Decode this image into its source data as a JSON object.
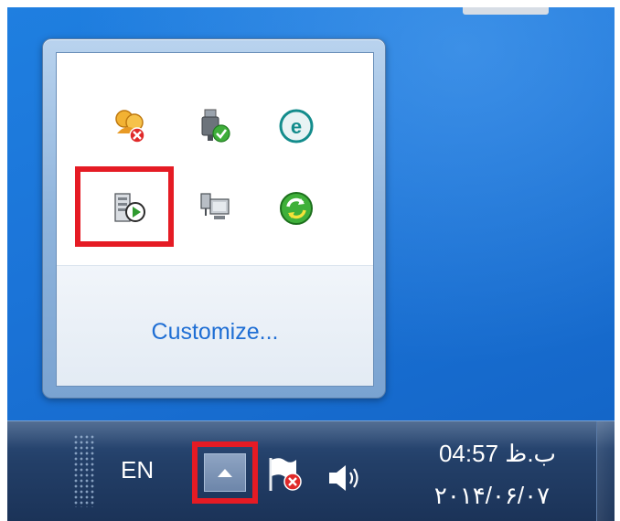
{
  "flyout": {
    "customize_label": "Customize...",
    "icons": [
      {
        "name": "security-alert-icon"
      },
      {
        "name": "safely-remove-hardware-icon"
      },
      {
        "name": "eset-antivirus-icon"
      },
      {
        "name": "server-play-icon"
      },
      {
        "name": "network-connection-icon"
      },
      {
        "name": "sync-update-icon"
      }
    ]
  },
  "taskbar": {
    "language": "EN",
    "clock_time": "ب.ظ 04:57",
    "clock_date": "۲۰۱۴/۰۶/۰۷"
  },
  "colors": {
    "highlight": "#e51b24",
    "desktop_blue": "#1b74d8",
    "link_blue": "#1e6ed4"
  }
}
